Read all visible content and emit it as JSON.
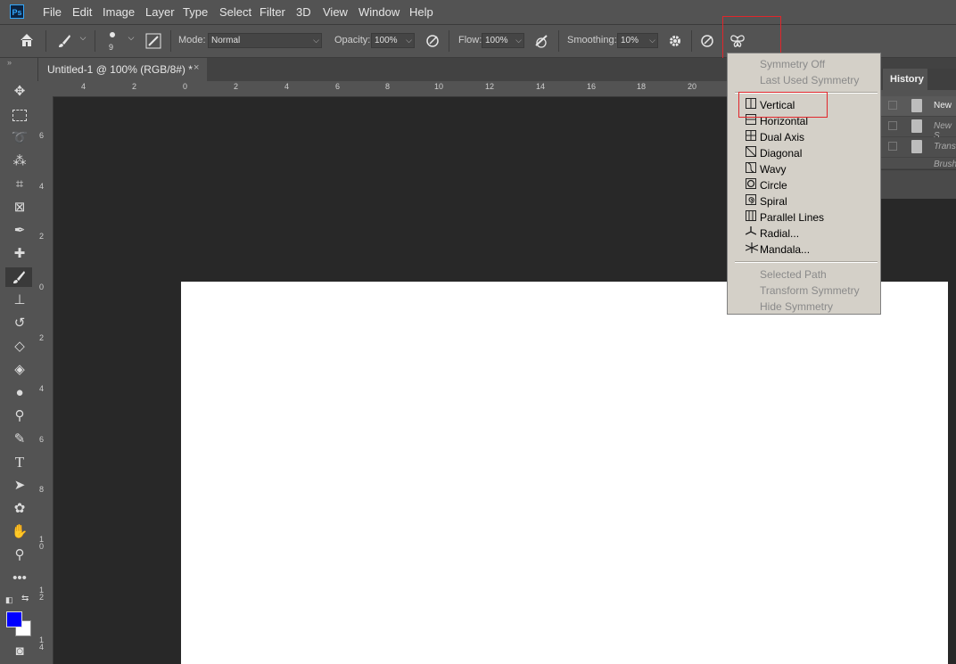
{
  "app": {
    "logo": "Ps"
  },
  "menubar": {
    "items": [
      "File",
      "Edit",
      "Image",
      "Layer",
      "Type",
      "Select",
      "Filter",
      "3D",
      "View",
      "Window",
      "Help"
    ]
  },
  "options": {
    "brush_size": "9",
    "mode_label": "Mode:",
    "mode_value": "Normal",
    "opacity_label": "Opacity:",
    "opacity_value": "100%",
    "flow_label": "Flow:",
    "flow_value": "100%",
    "smoothing_label": "Smoothing:",
    "smoothing_value": "10%"
  },
  "document": {
    "tab_title": "Untitled-1 @ 100% (RGB/8#) *",
    "close_glyph": "×"
  },
  "rulers": {
    "top": [
      "4",
      "2",
      "0",
      "2",
      "4",
      "6",
      "8",
      "10",
      "12",
      "14",
      "16",
      "18",
      "20"
    ],
    "left": [
      "6",
      "4",
      "2",
      "0",
      "2",
      "4",
      "6",
      "8",
      "10",
      "12",
      "14"
    ]
  },
  "history_panel": {
    "tab": "History",
    "rows": [
      {
        "label": "New",
        "style": "normal"
      },
      {
        "label": "New S",
        "style": "dim"
      },
      {
        "label": "Trans",
        "style": "dim"
      },
      {
        "label": "Brush",
        "style": "dim"
      }
    ]
  },
  "symmetry_menu": {
    "top_items": [
      "Symmetry Off",
      "Last Used Symmetry"
    ],
    "items": [
      {
        "label": "Vertical",
        "icon": "vertical-symmetry-icon"
      },
      {
        "label": "Horizontal",
        "icon": "horizontal-symmetry-icon"
      },
      {
        "label": "Dual Axis",
        "icon": "dual-axis-icon"
      },
      {
        "label": "Diagonal",
        "icon": "diagonal-icon"
      },
      {
        "label": "Wavy",
        "icon": "wavy-icon"
      },
      {
        "label": "Circle",
        "icon": "circle-icon"
      },
      {
        "label": "Spiral",
        "icon": "spiral-icon"
      },
      {
        "label": "Parallel Lines",
        "icon": "parallel-lines-icon"
      },
      {
        "label": "Radial...",
        "icon": "radial-icon"
      },
      {
        "label": "Mandala...",
        "icon": "mandala-icon"
      }
    ],
    "bottom_items": [
      "Selected Path",
      "Transform Symmetry",
      "Hide Symmetry"
    ]
  },
  "colors": {
    "foreground": "#0000ff",
    "background": "#ffffff",
    "highlight": "#e0262b"
  }
}
